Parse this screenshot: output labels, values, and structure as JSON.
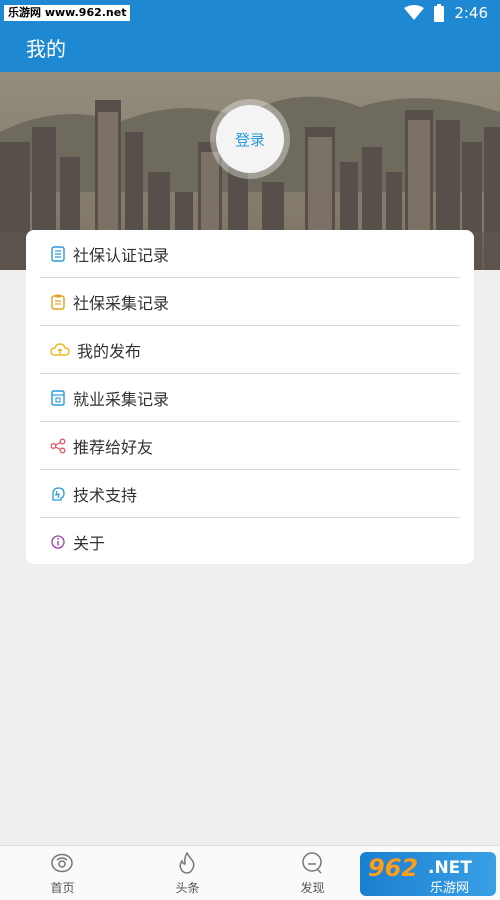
{
  "status_bar": {
    "watermark": "乐游网 www.962.net",
    "time": "2:46",
    "wifi_icon": "wifi-icon",
    "battery_icon": "battery-icon"
  },
  "app_bar": {
    "title": "我的"
  },
  "hero": {
    "image": "city-skyline-banner",
    "login_label": "登录"
  },
  "menu": {
    "items": [
      {
        "label": "社保认证记录",
        "icon": "list-doc-icon",
        "color": "#2a9ad8"
      },
      {
        "label": "社保采集记录",
        "icon": "clipboard-icon",
        "color": "#e3a11a"
      },
      {
        "label": "我的发布",
        "icon": "cloud-upload-icon",
        "color": "#f0b429"
      },
      {
        "label": "就业采集记录",
        "icon": "briefcase-doc-icon",
        "color": "#2a9ad8"
      },
      {
        "label": "推荐给好友",
        "icon": "share-icon",
        "color": "#e0565b"
      },
      {
        "label": "技术支持",
        "icon": "support-icon",
        "color": "#2a9ad8"
      },
      {
        "label": "关于",
        "icon": "info-icon",
        "color": "#9b3fa8"
      }
    ]
  },
  "tab_bar": {
    "tabs": [
      {
        "label": "首页",
        "icon": "home-icon"
      },
      {
        "label": "头条",
        "icon": "flame-icon"
      },
      {
        "label": "发现",
        "icon": "discover-icon"
      }
    ]
  },
  "watermark_logo": {
    "number": "962",
    "suffix": ".NET",
    "cn": "乐游网"
  },
  "colors": {
    "primary": "#1e88d2",
    "login_text": "#2a9ad8",
    "background": "#efefef"
  }
}
